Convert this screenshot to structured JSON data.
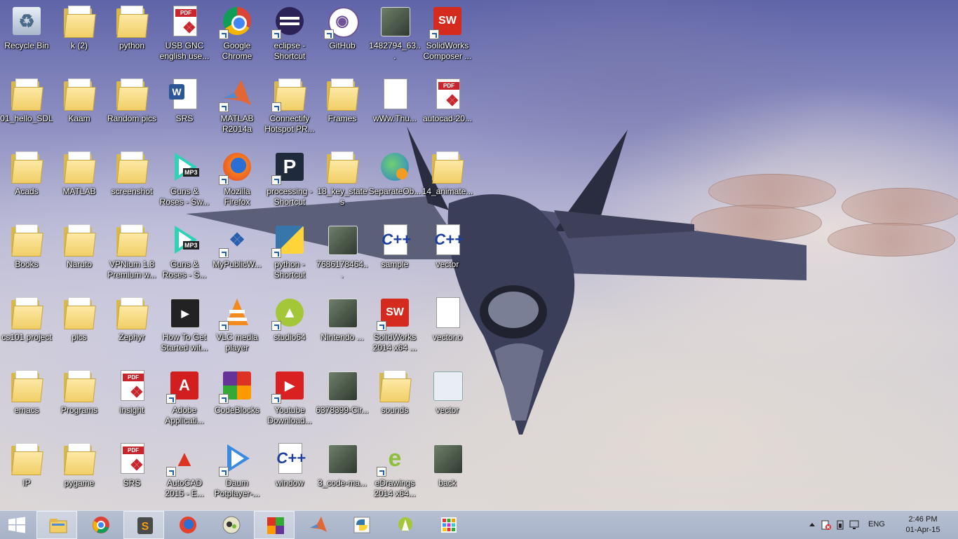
{
  "desktop": {
    "icons": [
      {
        "label": "Recycle Bin",
        "type": "recycle",
        "shortcut": false
      },
      {
        "label": "k (2)",
        "type": "folder",
        "shortcut": false
      },
      {
        "label": "python",
        "type": "folder",
        "shortcut": false
      },
      {
        "label": "USB GNC english use...",
        "type": "pdf",
        "shortcut": false
      },
      {
        "label": "Google Chrome",
        "type": "chrome",
        "shortcut": true
      },
      {
        "label": "eclipse - Shortcut",
        "type": "eclipse",
        "shortcut": true
      },
      {
        "label": "GitHub",
        "type": "github",
        "shortcut": true
      },
      {
        "label": "1482794_63...",
        "type": "image",
        "shortcut": false
      },
      {
        "label": "SolidWorks Composer ...",
        "type": "solidworks",
        "shortcut": true
      },
      {
        "label": "01_hello_SDL",
        "type": "folder",
        "shortcut": false
      },
      {
        "label": "Kaam",
        "type": "folder",
        "shortcut": false
      },
      {
        "label": "Random pics",
        "type": "folder",
        "shortcut": false
      },
      {
        "label": "SRS",
        "type": "word",
        "shortcut": false
      },
      {
        "label": "MATLAB R2014a",
        "type": "matlab",
        "shortcut": true
      },
      {
        "label": "Connectify Hotspot PR...",
        "type": "folder",
        "shortcut": true
      },
      {
        "label": "Frames",
        "type": "folder",
        "shortcut": false
      },
      {
        "label": "wWw.Thu...",
        "type": "text",
        "shortcut": false
      },
      {
        "label": "autocad-20...",
        "type": "pdf",
        "shortcut": false
      },
      {
        "label": "Acads",
        "type": "folder",
        "shortcut": false
      },
      {
        "label": "MATLAB",
        "type": "folder",
        "shortcut": false
      },
      {
        "label": "screenshot",
        "type": "folder",
        "shortcut": false
      },
      {
        "label": "Guns & Roses - Sw...",
        "type": "mp3",
        "shortcut": false
      },
      {
        "label": "Mozilla Firefox",
        "type": "firefox",
        "shortcut": true
      },
      {
        "label": "processing - Shortcut",
        "type": "processing",
        "shortcut": true
      },
      {
        "label": "18_key_states",
        "type": "folder",
        "shortcut": false
      },
      {
        "label": "SeparateOb...",
        "type": "globe",
        "shortcut": false
      },
      {
        "label": "14_animate...",
        "type": "folder",
        "shortcut": false
      },
      {
        "label": "Books",
        "type": "folder",
        "shortcut": false
      },
      {
        "label": "Naruto",
        "type": "folder",
        "shortcut": false
      },
      {
        "label": "VPNium 1.8 Premium w...",
        "type": "folder",
        "shortcut": false
      },
      {
        "label": "Guns & Roses - S...",
        "type": "mp3",
        "shortcut": false
      },
      {
        "label": "MyPublicW...",
        "type": "wifi",
        "shortcut": true
      },
      {
        "label": "python - Shortcut",
        "type": "python",
        "shortcut": true
      },
      {
        "label": "7686178464...",
        "type": "image",
        "shortcut": false
      },
      {
        "label": "sample",
        "type": "cpp",
        "shortcut": false
      },
      {
        "label": "vector",
        "type": "cpp",
        "shortcut": false
      },
      {
        "label": "cs101 project",
        "type": "folder",
        "shortcut": false
      },
      {
        "label": "pics",
        "type": "folder",
        "shortcut": false
      },
      {
        "label": "Zephyr",
        "type": "folder",
        "shortcut": false
      },
      {
        "label": "How To Get Started wit...",
        "type": "video",
        "shortcut": false
      },
      {
        "label": "VLC media player",
        "type": "vlc",
        "shortcut": true
      },
      {
        "label": "studio64",
        "type": "android",
        "shortcut": true
      },
      {
        "label": "Nintendo ...",
        "type": "image",
        "shortcut": false
      },
      {
        "label": "SolidWorks 2014 x64 ...",
        "type": "solidworks",
        "shortcut": true
      },
      {
        "label": "vector.o",
        "type": "blank",
        "shortcut": false
      },
      {
        "label": "emacs",
        "type": "folder",
        "shortcut": false
      },
      {
        "label": "Programs",
        "type": "folder",
        "shortcut": false
      },
      {
        "label": "insight",
        "type": "pdf",
        "shortcut": false
      },
      {
        "label": "Adobe Applicati...",
        "type": "adobe",
        "shortcut": true
      },
      {
        "label": "CodeBlocks",
        "type": "codeblocks",
        "shortcut": true
      },
      {
        "label": "Youtube Download...",
        "type": "youtube",
        "shortcut": true
      },
      {
        "label": "6378399-Cir...",
        "type": "image",
        "shortcut": false
      },
      {
        "label": "sounds",
        "type": "folder",
        "shortcut": false
      },
      {
        "label": "vector",
        "type": "app",
        "shortcut": false
      },
      {
        "label": "IP",
        "type": "folder",
        "shortcut": false
      },
      {
        "label": "pygame",
        "type": "folder",
        "shortcut": false
      },
      {
        "label": "SRS",
        "type": "pdf",
        "shortcut": false
      },
      {
        "label": "AutoCAD 2015 - E...",
        "type": "autocad",
        "shortcut": true
      },
      {
        "label": "Daum Potplayer-...",
        "type": "potplayer",
        "shortcut": true
      },
      {
        "label": "window",
        "type": "cpp",
        "shortcut": false
      },
      {
        "label": "3_code-ma...",
        "type": "image",
        "shortcut": false
      },
      {
        "label": "eDrawings 2014 x64...",
        "type": "edrawings",
        "shortcut": true
      },
      {
        "label": "back",
        "type": "image",
        "shortcut": false
      }
    ]
  },
  "taskbar": {
    "items": [
      {
        "name": "file-explorer",
        "active": true
      },
      {
        "name": "chrome",
        "active": false
      },
      {
        "name": "sublime-text",
        "active": true
      },
      {
        "name": "firefox",
        "active": false
      },
      {
        "name": "camera",
        "active": false
      },
      {
        "name": "codeblocks",
        "active": true
      },
      {
        "name": "matlab",
        "active": false
      },
      {
        "name": "python",
        "active": false
      },
      {
        "name": "android-studio",
        "active": false
      },
      {
        "name": "apps-grid",
        "active": false
      }
    ],
    "language": "ENG",
    "time": "2:46 PM",
    "date": "01-Apr-15"
  },
  "colors": {
    "taskbar": "#aab4c9",
    "folder": "#f1cf66",
    "pdf_red": "#c8262c"
  }
}
